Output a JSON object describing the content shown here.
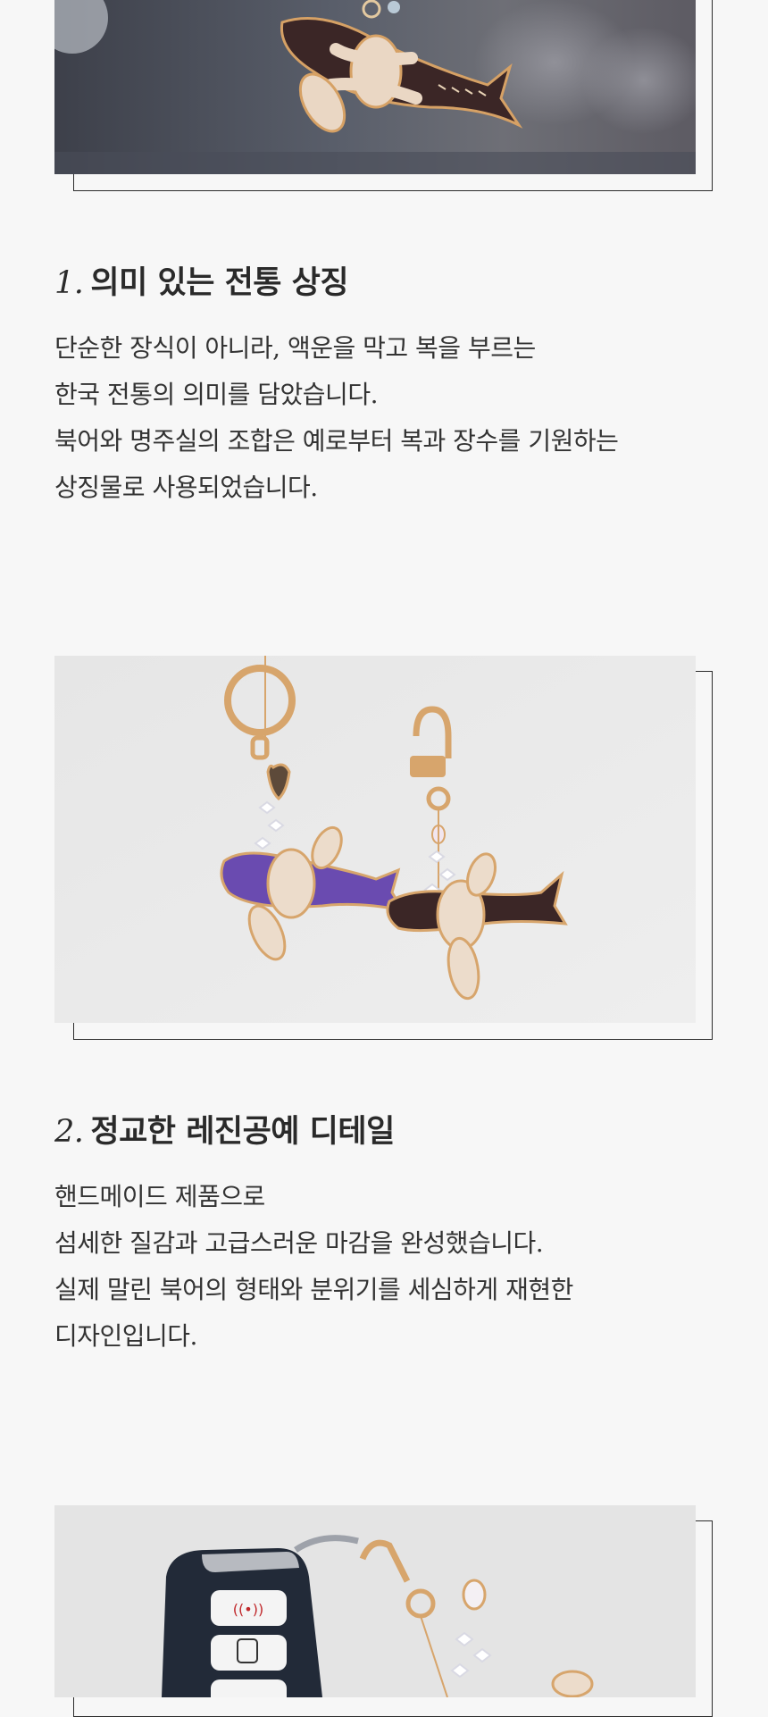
{
  "sections": [
    {
      "number": "1.",
      "title": "의미 있는 전통 상징",
      "image_alt": "북어 키링 (다크 브라운)",
      "lines": [
        "단순한 장식이 아니라, 액운을 막고 복을 부르는",
        "한국 전통의 의미를 담았습니다.",
        "북어와 명주실의 조합은 예로부터 복과 장수를 기원하는",
        "상징물로 사용되었습니다."
      ]
    },
    {
      "number": "2.",
      "title": "정교한 레진공예 디테일",
      "image_alt": "북어 키링 두 종 (퍼플, 다크 브라운)",
      "lines": [
        "핸드메이드 제품으로",
        "섬세한 질감과 고급스러운 마감을 완성했습니다.",
        "실제 말린 북어의 형태와 분위기를 세심하게 재현한",
        "디자인입니다."
      ]
    }
  ],
  "third_image_alt": "자동차 스마트키에 단 북어 키링",
  "colors": {
    "background": "#f7f7f7",
    "frame": "#2b2b2b",
    "fish_dark": "#3b2626",
    "fish_purple": "#6a4bb0",
    "gold": "#d6a165"
  }
}
